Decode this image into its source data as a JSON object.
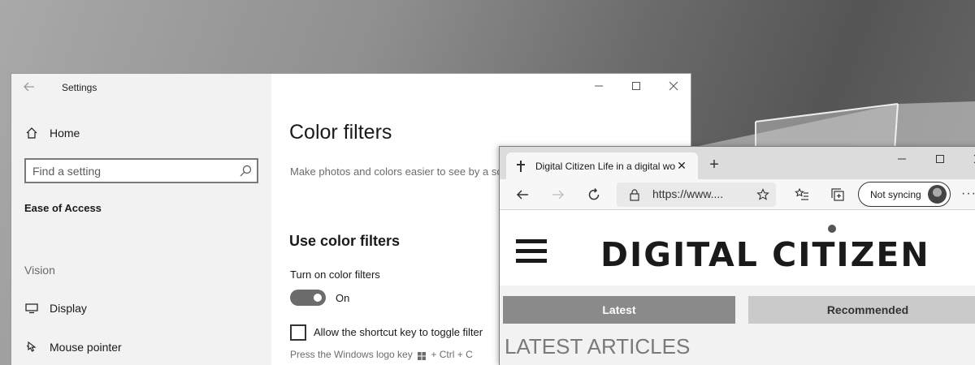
{
  "settings_window": {
    "title": "Settings",
    "sidebar": {
      "home_label": "Home",
      "search_placeholder": "Find a setting",
      "section_title": "Ease of Access",
      "group_title": "Vision",
      "items": [
        {
          "label": "Display",
          "icon": "monitor-icon"
        },
        {
          "label": "Mouse pointer",
          "icon": "mouse-pointer-icon"
        }
      ]
    },
    "content": {
      "page_title": "Color filters",
      "description": "Make photos and colors easier to see by a screen.",
      "subheading": "Use color filters",
      "toggle_label": "Turn on color filters",
      "toggle_state": "On",
      "toggle_on": true,
      "checkbox_label": "Allow the shortcut key to toggle filter",
      "checkbox_checked": false,
      "hint_before": "Press the Windows logo key",
      "hint_after": "+ Ctrl + C"
    }
  },
  "browser_window": {
    "tab_title": "Digital Citizen Life in a digital wo",
    "url": "https://www....",
    "sync_label": "Not syncing",
    "site": {
      "logo_text": "DIGITAL CITIZEN",
      "tabs": [
        "Latest",
        "Recommended"
      ],
      "section_heading": "LATEST ARTICLES"
    }
  },
  "colors": {
    "settings_sidebar": "#f2f2f2",
    "toggle_on": "#6c6c6c",
    "site_tab_active": "#8a8a8a",
    "site_tab_inactive": "#cacaca"
  }
}
